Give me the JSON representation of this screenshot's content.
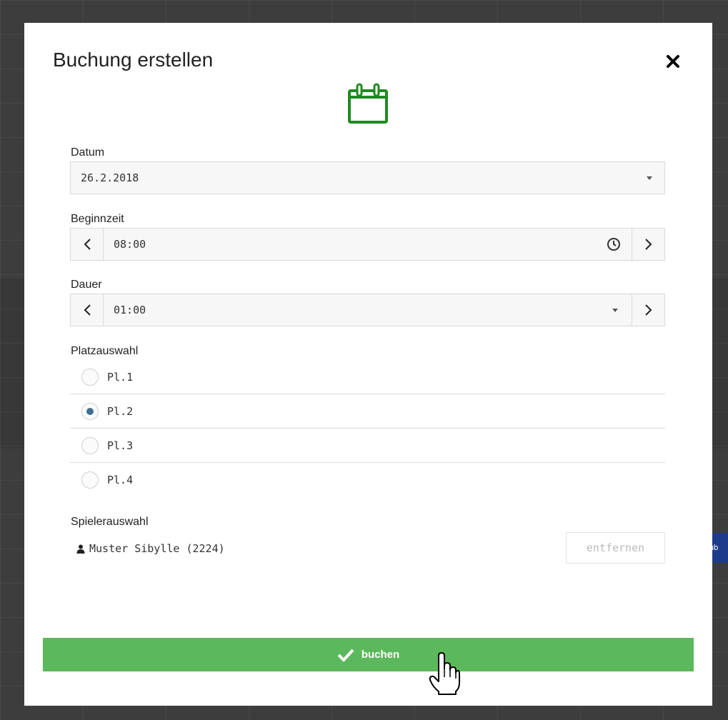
{
  "modal": {
    "title": "Buchung erstellen",
    "close_icon": "close-icon",
    "header_icon": "calendar-icon",
    "accent_color": "#1f8a1f"
  },
  "form": {
    "date": {
      "label": "Datum",
      "value": "26.2.2018"
    },
    "start_time": {
      "label": "Beginnzeit",
      "value": "08:00"
    },
    "duration": {
      "label": "Dauer",
      "value": "01:00"
    },
    "court": {
      "label": "Platzauswahl",
      "options": [
        {
          "label": "Pl.1",
          "selected": false
        },
        {
          "label": "Pl.2",
          "selected": true
        },
        {
          "label": "Pl.3",
          "selected": false
        },
        {
          "label": "Pl.4",
          "selected": false
        }
      ]
    },
    "players": {
      "label": "Spielerauswahl",
      "items": [
        {
          "name": "Muster Sibylle (2224)"
        }
      ],
      "remove_label": "entfernen"
    }
  },
  "actions": {
    "book_label": "buchen",
    "book_color": "#5cb85c"
  }
}
